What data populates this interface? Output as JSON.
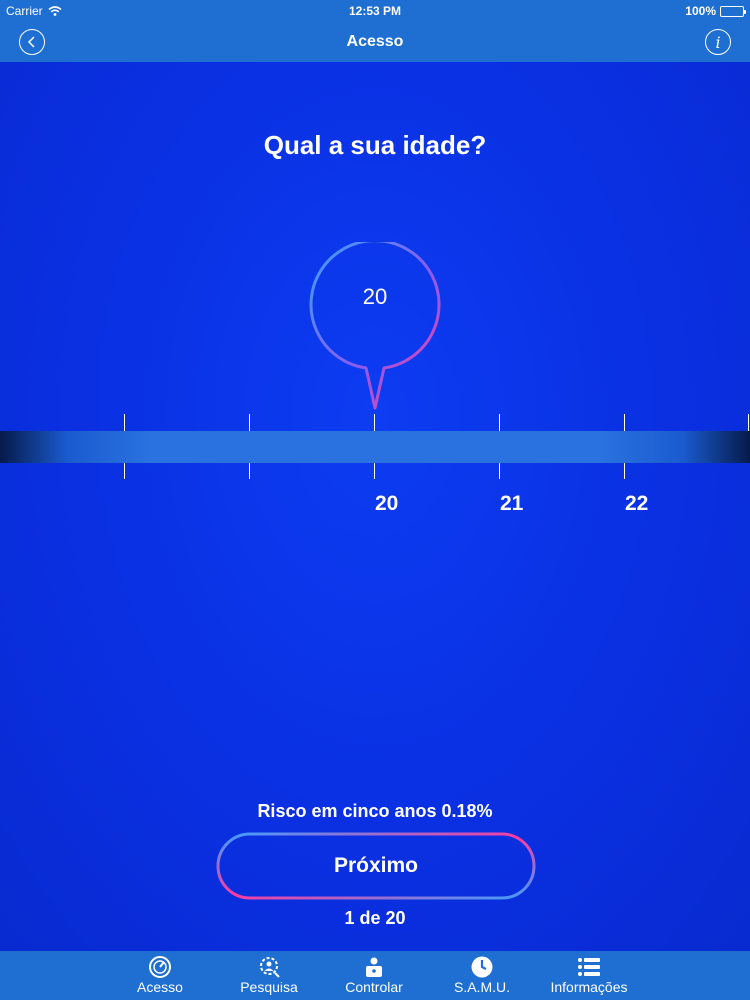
{
  "status_bar": {
    "carrier": "Carrier",
    "time": "12:53 PM",
    "battery": "100%"
  },
  "nav": {
    "title": "Acesso"
  },
  "question": {
    "title": "Qual a sua idade?"
  },
  "selector": {
    "selected_value": "20",
    "ruler_labels": [
      "20",
      "21",
      "22"
    ]
  },
  "footer": {
    "risk_text": "Risco em cinco anos 0.18%",
    "next_button_label": "Próximo",
    "page_indicator": "1 de 20"
  },
  "tabs": [
    {
      "label": "Acesso",
      "icon": "gauge-icon"
    },
    {
      "label": "Pesquisa",
      "icon": "search-person-icon"
    },
    {
      "label": "Controlar",
      "icon": "person-lock-icon"
    },
    {
      "label": "S.A.M.U.",
      "icon": "clock-icon"
    },
    {
      "label": "Informações",
      "icon": "list-icon"
    }
  ],
  "colors": {
    "background": "#0a2fe0",
    "bar": "#1e6fd1",
    "accent_pink": "#ff3aa0",
    "accent_blue": "#3aa0ff"
  }
}
